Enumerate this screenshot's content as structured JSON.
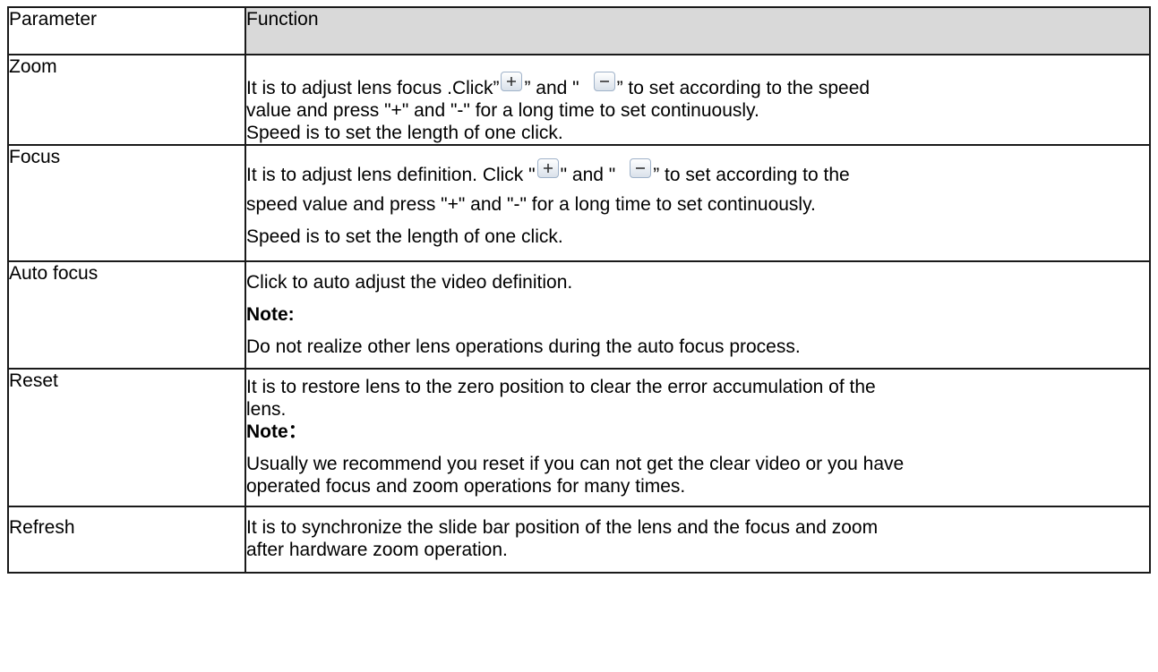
{
  "header": {
    "param": "Parameter",
    "function": "Function"
  },
  "rows": [
    {
      "param": "Zoom",
      "lines": [
        {
          "a": "It is to adjust lens focus .Click”",
          "b": "” and \"",
          "c": "” to set according to the speed"
        },
        "value and press \"+\" and \"-\" for a long time to set continuously.",
        "Speed is to set the length of one click."
      ]
    },
    {
      "param": "Focus",
      "lines": [
        {
          "a": "It is to adjust lens definition. Click \"",
          "b": "\" and \"",
          "c": "” to set according to the"
        },
        "speed value and press \"+\" and \"-\" for a long time to set continuously.",
        "Speed is to set the length of one click."
      ]
    },
    {
      "param": "Auto focus",
      "lines": [
        "Click to auto adjust the video definition.",
        "Note:",
        "Do not realize other lens operations during the auto focus process."
      ]
    },
    {
      "param": "Reset",
      "lines": [
        "It is to restore lens to the zero position to clear the error accumulation of the",
        "lens.",
        "Note：",
        "Usually we recommend you reset if you can not get the clear video or you have",
        "operated focus and zoom operations for many times."
      ]
    },
    {
      "param": "Refresh",
      "lines": [
        "It is to synchronize the slide bar position of the lens and the focus and zoom",
        "after hardware zoom operation."
      ]
    }
  ],
  "icons": {
    "plus": "plus-button-icon",
    "minus": "minus-button-icon"
  }
}
